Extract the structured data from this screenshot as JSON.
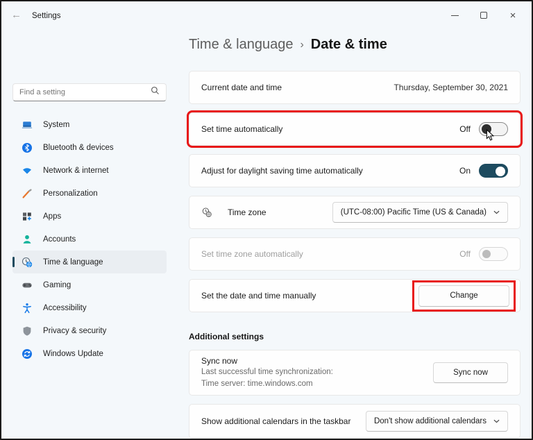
{
  "titlebar": {
    "title": "Settings",
    "back_icon": "←"
  },
  "breadcrumb": {
    "section": "Time & language",
    "separator": "›",
    "page": "Date & time"
  },
  "sidebar": {
    "search": {
      "placeholder": "Find a setting"
    },
    "items": [
      {
        "label": "System",
        "icon": "laptop-icon"
      },
      {
        "label": "Bluetooth & devices",
        "icon": "bluetooth-icon"
      },
      {
        "label": "Network & internet",
        "icon": "wifi-icon"
      },
      {
        "label": "Personalization",
        "icon": "brush-icon"
      },
      {
        "label": "Apps",
        "icon": "apps-grid-icon"
      },
      {
        "label": "Accounts",
        "icon": "person-icon"
      },
      {
        "label": "Time & language",
        "icon": "clock-globe-icon",
        "selected": true
      },
      {
        "label": "Gaming",
        "icon": "gamepad-icon"
      },
      {
        "label": "Accessibility",
        "icon": "accessibility-icon"
      },
      {
        "label": "Privacy & security",
        "icon": "shield-icon"
      },
      {
        "label": "Windows Update",
        "icon": "update-icon"
      }
    ]
  },
  "settings": {
    "current_datetime": {
      "label": "Current date and time",
      "value": "Thursday, September 30, 2021"
    },
    "set_time_auto": {
      "label": "Set time automatically",
      "state": "Off",
      "highlighted": true
    },
    "daylight_saving": {
      "label": "Adjust for daylight saving time automatically",
      "state": "On"
    },
    "time_zone": {
      "label": "Time zone",
      "value": "(UTC-08:00) Pacific Time (US & Canada)",
      "icon": "timezone-clock-globe-icon"
    },
    "set_zone_auto": {
      "label": "Set time zone automatically",
      "state": "Off",
      "disabled": true
    },
    "manual_datetime": {
      "label": "Set the date and time manually",
      "button": "Change",
      "highlighted": true
    },
    "additional_heading": "Additional settings",
    "sync": {
      "title": "Sync now",
      "line1": "Last successful time synchronization:",
      "line2": "Time server: time.windows.com",
      "button": "Sync now"
    },
    "calendars": {
      "label": "Show additional calendars in the taskbar",
      "value": "Don't show additional calendars"
    }
  },
  "colors": {
    "accent_toggle": "#1d4b5f",
    "highlight_red": "#e81717",
    "window_bg": "#f4f8fb",
    "card_bg": "#fefefe"
  }
}
